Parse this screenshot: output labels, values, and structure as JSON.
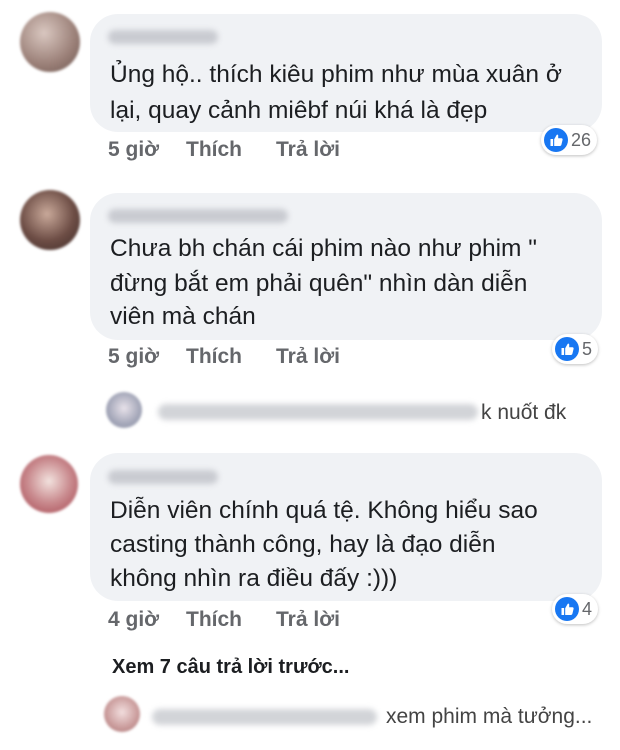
{
  "comments": [
    {
      "text_lines": [
        "Ủng hộ.. thích kiêu phim như  mùa xuân ở",
        "lại, quay cảnh miêbf núi khá là đẹp"
      ],
      "time": "5 giờ",
      "like_label": "Thích",
      "reply_label": "Trả lời",
      "reactions": "26"
    },
    {
      "text_lines": [
        "Chưa bh chán cái phim nào như phim \"",
        "đừng bắt em phải quên\" nhìn dàn diễn",
        "viên mà chán"
      ],
      "time": "5 giờ",
      "like_label": "Thích",
      "reply_label": "Trả lời",
      "reactions": "5"
    },
    {
      "text_lines": [
        "Diễn viên chính quá tệ. Không hiểu sao",
        "casting thành công, hay là đạo diễn",
        "không nhìn ra điều đấy :)))"
      ],
      "time": "4 giờ",
      "like_label": "Thích",
      "reply_label": "Trả lời",
      "reactions": "4"
    }
  ],
  "reply_previews": [
    {
      "text": "k nuốt đk"
    },
    {
      "text": "xem phim mà tưởng..."
    }
  ],
  "view_more": "Xem 7 câu trả lời trước...",
  "colors": {
    "bubble": "#f0f2f5",
    "meta": "#65676b",
    "like_blue": "#1877f2"
  }
}
